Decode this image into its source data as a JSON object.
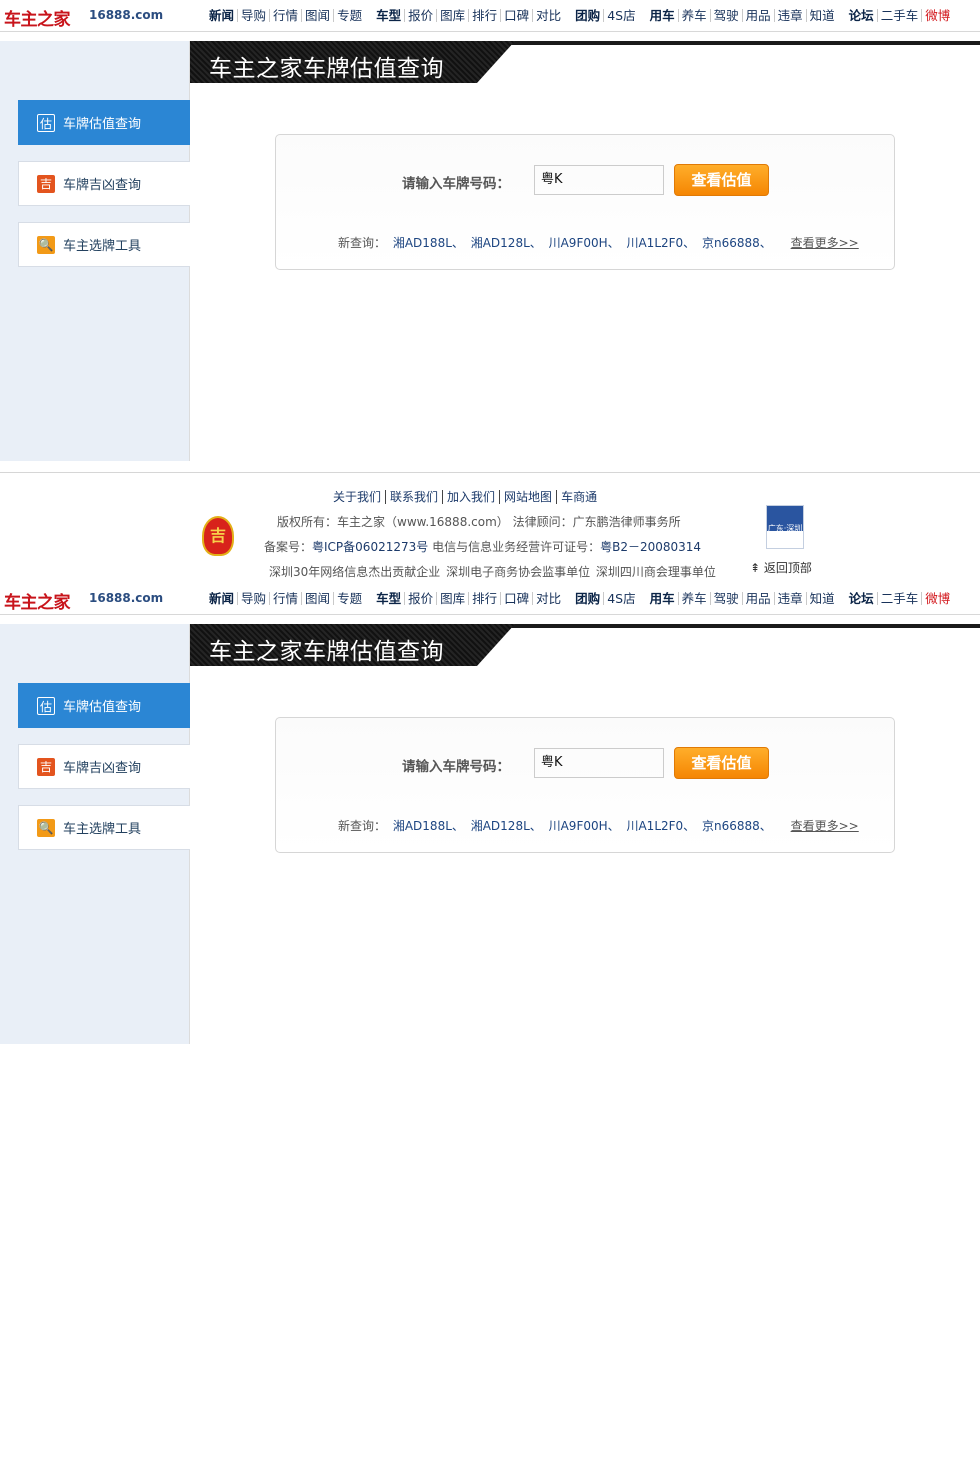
{
  "nav": {
    "logo": "车主之家",
    "domain": "16888.com",
    "links": [
      {
        "label": "新闻",
        "bold": true
      },
      {
        "label": "导购"
      },
      {
        "label": "行情"
      },
      {
        "label": "图闻"
      },
      {
        "label": "专题"
      },
      {
        "label": "车型",
        "bold": true,
        "gap": true
      },
      {
        "label": "报价"
      },
      {
        "label": "图库"
      },
      {
        "label": "排行"
      },
      {
        "label": "口碑"
      },
      {
        "label": "对比"
      },
      {
        "label": "团购",
        "bold": true,
        "gap": true
      },
      {
        "label": "4S店"
      },
      {
        "label": "用车",
        "bold": true,
        "gap": true
      },
      {
        "label": "养车"
      },
      {
        "label": "驾驶"
      },
      {
        "label": "用品"
      },
      {
        "label": "违章"
      },
      {
        "label": "知道"
      },
      {
        "label": "论坛",
        "bold": true,
        "gap": true
      },
      {
        "label": "二手车"
      },
      {
        "label": "微博",
        "red": true
      }
    ]
  },
  "banner": {
    "title": "车主之家车牌估值查询"
  },
  "sidebar": {
    "items": [
      {
        "label": "车牌估值查询",
        "icon": "估",
        "icon_name": "estimate-icon",
        "active": true
      },
      {
        "label": "车牌吉凶查询",
        "icon": "吉",
        "icon_name": "fortune-icon"
      },
      {
        "label": "车主选牌工具",
        "icon": "🔍",
        "icon_name": "search-icon"
      }
    ]
  },
  "query": {
    "label": "请输入车牌号码：",
    "input_value": "粤K",
    "button": "查看估值",
    "recent_label": "新查询：",
    "recent": [
      "湘AD188L、",
      "湘AD128L、",
      "川A9F00H、",
      "川A1L2F0、",
      "京n66888、"
    ],
    "more": "查看更多>>"
  },
  "footer": {
    "links": [
      "关于我们",
      "联系我们",
      "加入我们",
      "网站地图",
      "车商通"
    ],
    "copyright": "版权所有：车主之家（www.16888.com） 法律顾问：广东鹏浩律师事务所",
    "icp_prefix": "备案号：",
    "icp": "粤ICP备06021273号",
    "license_prefix": "电信与信息业务经营许可证号：",
    "license": "粤B2－20080314",
    "honors": "深圳30年网络信息杰出贡献企业  深圳电子商务协会监事单位  深圳四川商会理事单位",
    "badge_text": "吉",
    "police_text": "广东·深圳",
    "back_top": "返回顶部"
  },
  "colors": {
    "accent": "#2b86d4",
    "button": "#f58603",
    "brand_red": "#c8141b"
  }
}
